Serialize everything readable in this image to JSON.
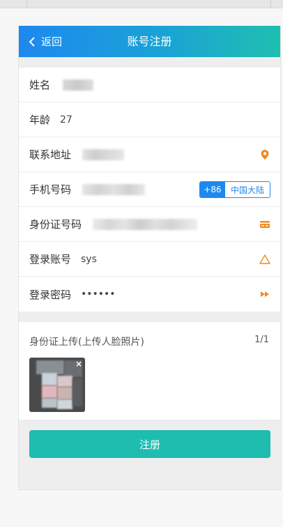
{
  "header": {
    "back_label": "返回",
    "title": "账号注册"
  },
  "form": {
    "name": {
      "label": "姓名"
    },
    "age": {
      "label": "年龄",
      "value": "27"
    },
    "address": {
      "label": "联系地址"
    },
    "phone": {
      "label": "手机号码",
      "country_code": "+86",
      "region": "中国大陆"
    },
    "id_number": {
      "label": "身份证号码"
    },
    "account": {
      "label": "登录账号",
      "value": "sys"
    },
    "password": {
      "label": "登录密码",
      "value": "••••••"
    }
  },
  "upload": {
    "title": "身份证上传(上传人脸照片)",
    "count": "1/1",
    "remove_symbol": "×"
  },
  "submit": {
    "label": "注册"
  },
  "colors": {
    "accent": "#1e88ee",
    "teal": "#1fbcb0",
    "icon_orange": "#f08a1c"
  },
  "icons": {
    "back": "chevron-left-icon",
    "address": "location-pin-icon",
    "id_number": "id-card-icon",
    "account": "triangle-warning-icon",
    "password": "fast-forward-icon"
  }
}
